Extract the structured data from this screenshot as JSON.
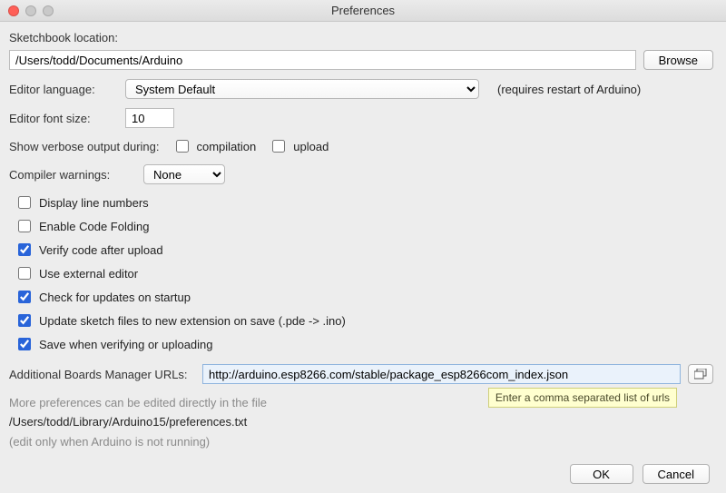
{
  "window": {
    "title": "Preferences"
  },
  "sketchbook": {
    "label": "Sketchbook location:",
    "path": "/Users/todd/Documents/Arduino",
    "browse": "Browse"
  },
  "editor_language": {
    "label": "Editor language:",
    "selected": "System Default",
    "hint": "(requires restart of Arduino)"
  },
  "font_size": {
    "label": "Editor font size:",
    "value": "10"
  },
  "verbose": {
    "label": "Show verbose output during:",
    "compilation_label": "compilation",
    "upload_label": "upload",
    "compilation_checked": false,
    "upload_checked": false
  },
  "compiler_warnings": {
    "label": "Compiler warnings:",
    "selected": "None"
  },
  "options": {
    "display_line_numbers": {
      "label": "Display line numbers",
      "checked": false
    },
    "code_folding": {
      "label": "Enable Code Folding",
      "checked": false
    },
    "verify_after_upload": {
      "label": "Verify code after upload",
      "checked": true
    },
    "external_editor": {
      "label": "Use external editor",
      "checked": false
    },
    "check_updates": {
      "label": "Check for updates on startup",
      "checked": true
    },
    "update_ext": {
      "label": "Update sketch files to new extension on save (.pde -> .ino)",
      "checked": true
    },
    "save_on_verify": {
      "label": "Save when verifying or uploading",
      "checked": true
    }
  },
  "boards_url": {
    "label": "Additional Boards Manager URLs:",
    "value": "http://arduino.esp8266.com/stable/package_esp8266com_index.json",
    "tooltip": "Enter a comma separated list of urls"
  },
  "more_prefs": {
    "line1": "More preferences can be edited directly in the file",
    "path": "/Users/todd/Library/Arduino15/preferences.txt",
    "line2": "(edit only when Arduino is not running)"
  },
  "footer": {
    "ok": "OK",
    "cancel": "Cancel"
  }
}
